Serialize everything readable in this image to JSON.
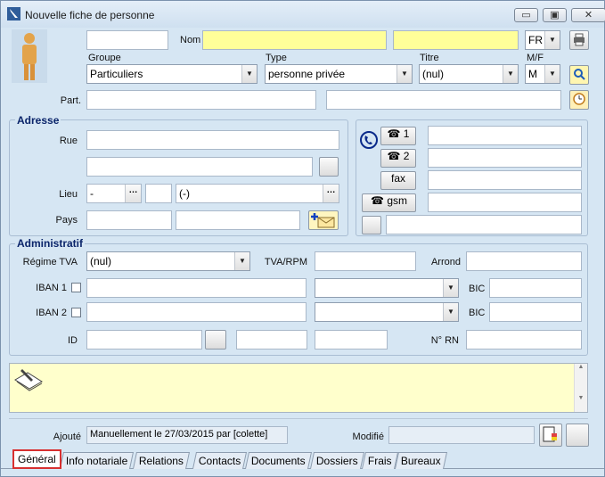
{
  "window": {
    "title": "Nouvelle fiche de personne",
    "minimize": "▭",
    "restore": "▣",
    "close": "✕"
  },
  "ident": {
    "nom_label": "Nom",
    "lang": "FR",
    "groupe_label": "Groupe",
    "groupe_value": "Particuliers",
    "type_label": "Type",
    "type_value": "personne privée",
    "titre_label": "Titre",
    "titre_value": "(nul)",
    "mf_label": "M/F",
    "mf_value": "M",
    "part_label": "Part."
  },
  "adresse": {
    "title": "Adresse",
    "rue_label": "Rue",
    "lieu_label": "Lieu",
    "lieu_code": "-",
    "lieu_city": "(-)",
    "pays_label": "Pays"
  },
  "phone": {
    "btn1": "1",
    "btn2": "2",
    "fax": "fax",
    "gsm": "gsm"
  },
  "admin": {
    "title": "Administratif",
    "regime_label": "Régime TVA",
    "regime_value": "(nul)",
    "tva_label": "TVA/RPM",
    "arrond_label": "Arrond",
    "iban1_label": "IBAN 1",
    "iban2_label": "IBAN 2",
    "bic1_label": "BIC",
    "bic2_label": "BIC",
    "id_label": "ID",
    "rn_label": "N° RN"
  },
  "footer": {
    "ajoute_label": "Ajouté",
    "ajoute_value": "Manuellement le 27/03/2015 par [colette]",
    "modifie_label": "Modifié"
  },
  "tabs": [
    "Général",
    "Info notariale",
    "Relations",
    "Contacts",
    "Documents",
    "Dossiers",
    "Frais",
    "Bureaux"
  ],
  "colors": {
    "background": "#d6e6f3",
    "highlight_field": "#ffff99",
    "note_area": "#ffffcc",
    "group_title": "#0a246a",
    "active_tab_border": "#d83030"
  }
}
